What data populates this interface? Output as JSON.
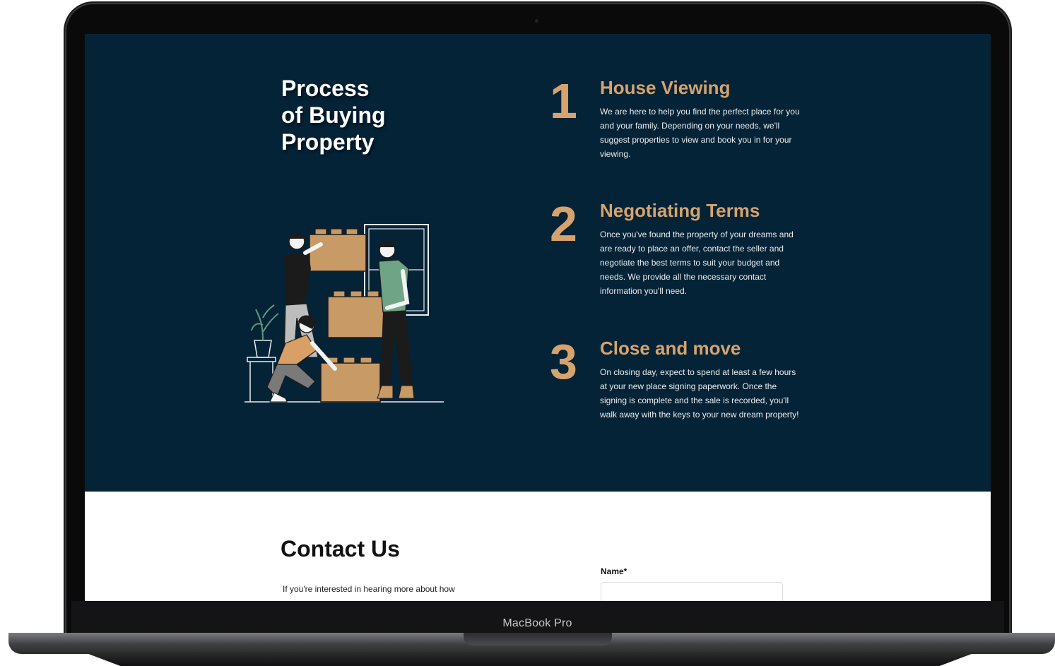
{
  "device": {
    "model_label": "MacBook Pro"
  },
  "process": {
    "title_lines": [
      "Process",
      "of Buying",
      "Property"
    ],
    "steps": [
      {
        "number": "1",
        "title": "House Viewing",
        "body": "We are here to help you find the perfect place for you and your family. Depending on your needs, we'll suggest properties to view and book you in for your viewing."
      },
      {
        "number": "2",
        "title": "Negotiating Terms",
        "body": "Once you've found the property of your dreams and are ready to place an offer, contact the seller and negotiate the best terms to suit your budget and needs. We provide all the necessary contact information you'll need."
      },
      {
        "number": "3",
        "title": "Close and move",
        "body": "On closing day, expect to spend at least a few hours at your new place signing paperwork. Once the signing is complete and the sale is recorded, you'll walk away with the keys to your new dream property!"
      }
    ]
  },
  "contact": {
    "title": "Contact Us",
    "intro": "If you're interested in hearing more about how",
    "name_label": "Name*",
    "name_value": "",
    "name_placeholder": ""
  },
  "colors": {
    "section_bg": "#052337",
    "accent": "#d6a36d",
    "body_text": "#e9edf0"
  },
  "icons": {
    "illustration": "people-moving-boxes-illustration"
  }
}
